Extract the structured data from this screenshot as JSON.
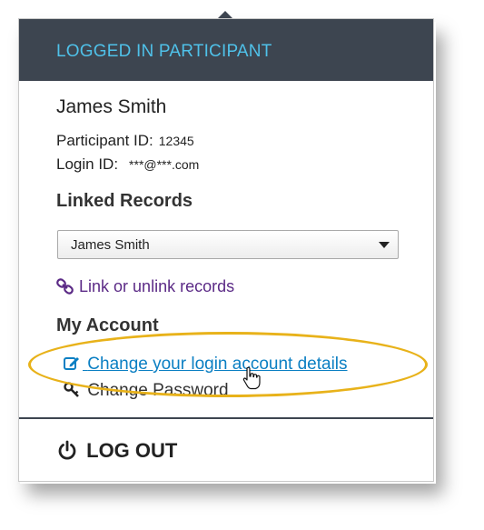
{
  "header": {
    "title": "LOGGED IN PARTICIPANT"
  },
  "participant": {
    "name": "James Smith",
    "id_label": "Participant ID:",
    "id_value": "12345",
    "login_label": "Login ID:",
    "login_value": "***@***.com"
  },
  "linked_records": {
    "title": "Linked Records",
    "selected": "James Smith",
    "link_text": "Link or unlink records"
  },
  "my_account": {
    "title": "My Account",
    "change_details": "Change your login account details",
    "change_password": "Change Password"
  },
  "logout": {
    "label": "LOG OUT"
  },
  "colors": {
    "header_bg": "#3d4550",
    "header_text": "#4fc1e9",
    "link_blue": "#0b7fc3",
    "link_purple": "#5b2a86",
    "highlight": "#e8b21a"
  }
}
